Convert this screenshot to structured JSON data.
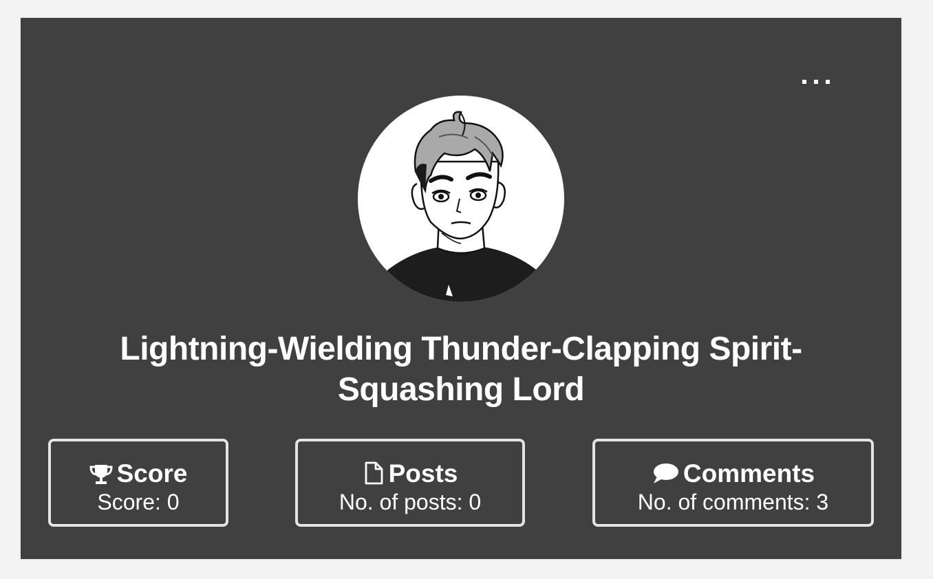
{
  "profile": {
    "name": "Lightning-Wielding Thunder-Clapping Spirit-Squashing Lord",
    "avatar_icon": "manga-style-boy-avatar",
    "menu_icon": "ellipsis-icon"
  },
  "stats": {
    "score": {
      "icon": "trophy-icon",
      "title": "Score",
      "value": "Score: 0"
    },
    "posts": {
      "icon": "document-icon",
      "title": "Posts",
      "value": "No. of posts: 0"
    },
    "comments": {
      "icon": "speech-bubble-icon",
      "title": "Comments",
      "value": "No. of comments: 3"
    }
  },
  "colors": {
    "page_background": "#f3f3f3",
    "card_background": "#404040",
    "text": "#ffffff",
    "stat_border": "#e4e4e4"
  }
}
